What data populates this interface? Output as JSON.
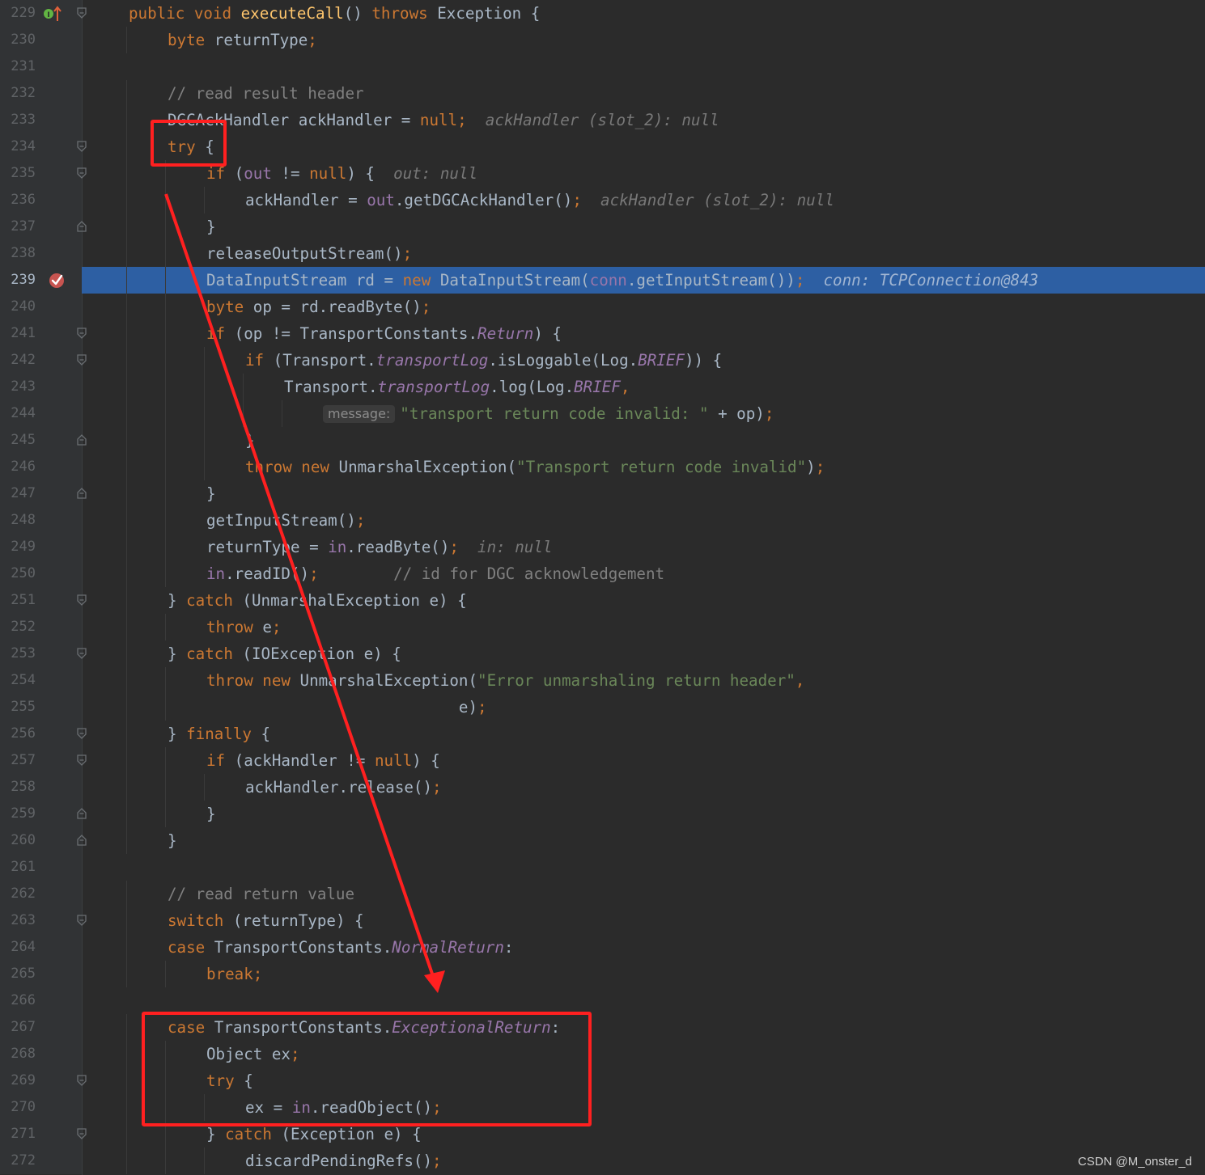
{
  "editor": {
    "lines": [
      {
        "n": "229",
        "indent": 0,
        "fold": "open",
        "seg": [
          [
            "kw",
            "public void "
          ],
          [
            "fn",
            "executeCall"
          ],
          [
            "",
            "() "
          ],
          [
            "kw",
            "throws "
          ],
          [
            "",
            "Exception {"
          ]
        ]
      },
      {
        "n": "230",
        "indent": 1,
        "seg": [
          [
            "kw",
            "byte "
          ],
          [
            "",
            "returnType"
          ],
          [
            "kw",
            ";"
          ]
        ]
      },
      {
        "n": "231",
        "indent": 0,
        "seg": []
      },
      {
        "n": "232",
        "indent": 1,
        "seg": [
          [
            "cmt",
            "// read result header"
          ]
        ]
      },
      {
        "n": "233",
        "indent": 1,
        "seg": [
          [
            "",
            "DGCAckHandler ackHandler = "
          ],
          [
            "kw",
            "null;"
          ],
          [
            "",
            "  "
          ],
          [
            "hint",
            "ackHandler (slot_2): null"
          ]
        ]
      },
      {
        "n": "234",
        "indent": 1,
        "fold": "open",
        "seg": [
          [
            "kw",
            "try "
          ],
          [
            "",
            "{"
          ]
        ]
      },
      {
        "n": "235",
        "indent": 2,
        "fold": "open",
        "seg": [
          [
            "kw",
            "if "
          ],
          [
            "",
            "("
          ],
          [
            "fld",
            "out"
          ],
          [
            "",
            " != "
          ],
          [
            "kw",
            "null"
          ],
          [
            "",
            ") {  "
          ],
          [
            "hint",
            "out: null"
          ]
        ]
      },
      {
        "n": "236",
        "indent": 3,
        "seg": [
          [
            "",
            "ackHandler = "
          ],
          [
            "fld",
            "out"
          ],
          [
            "",
            ".getDGCAckHandler()"
          ],
          [
            "kw",
            ";"
          ],
          [
            "",
            "  "
          ],
          [
            "hint",
            "ackHandler (slot_2): null"
          ]
        ]
      },
      {
        "n": "237",
        "indent": 2,
        "fold": "close",
        "seg": [
          [
            "",
            "}"
          ]
        ]
      },
      {
        "n": "238",
        "indent": 2,
        "seg": [
          [
            "",
            "releaseOutputStream()"
          ],
          [
            "kw",
            ";"
          ]
        ]
      },
      {
        "n": "239",
        "indent": 2,
        "hl": true,
        "seg": [
          [
            "",
            "DataInputStream rd = "
          ],
          [
            "kw",
            "new "
          ],
          [
            "",
            "DataInputStream("
          ],
          [
            "fld",
            "conn"
          ],
          [
            "",
            ".getInputStream())"
          ],
          [
            "kw",
            ";"
          ],
          [
            "",
            "  "
          ],
          [
            "hint",
            "conn: TCPConnection@843"
          ]
        ]
      },
      {
        "n": "240",
        "indent": 2,
        "seg": [
          [
            "kw",
            "byte "
          ],
          [
            "",
            "op = rd.readByte()"
          ],
          [
            "kw",
            ";"
          ]
        ]
      },
      {
        "n": "241",
        "indent": 2,
        "fold": "open",
        "seg": [
          [
            "kw",
            "if "
          ],
          [
            "",
            "(op != TransportConstants."
          ],
          [
            "ist",
            "Return"
          ],
          [
            "",
            ") {"
          ]
        ]
      },
      {
        "n": "242",
        "indent": 3,
        "fold": "open",
        "seg": [
          [
            "kw",
            "if "
          ],
          [
            "",
            "(Transport."
          ],
          [
            "ist",
            "transportLog"
          ],
          [
            "",
            ".isLoggable(Log."
          ],
          [
            "ist",
            "BRIEF"
          ],
          [
            "",
            ")) {"
          ]
        ]
      },
      {
        "n": "243",
        "indent": 4,
        "seg": [
          [
            "",
            "Transport."
          ],
          [
            "ist",
            "transportLog"
          ],
          [
            "",
            ".log(Log."
          ],
          [
            "ist",
            "BRIEF"
          ],
          [
            "kw",
            ","
          ]
        ]
      },
      {
        "n": "244",
        "indent": 5,
        "seg": [
          [
            "param",
            "message:"
          ],
          [
            "str",
            "\"transport return code invalid: \""
          ],
          [
            "",
            " + op)"
          ],
          [
            "kw",
            ";"
          ]
        ]
      },
      {
        "n": "245",
        "indent": 3,
        "fold": "close",
        "seg": [
          [
            "",
            "}"
          ]
        ]
      },
      {
        "n": "246",
        "indent": 3,
        "seg": [
          [
            "kw",
            "throw new "
          ],
          [
            "",
            "UnmarshalException("
          ],
          [
            "str",
            "\"Transport return code invalid\""
          ],
          [
            "",
            ")"
          ],
          [
            "kw",
            ";"
          ]
        ]
      },
      {
        "n": "247",
        "indent": 2,
        "fold": "close",
        "seg": [
          [
            "",
            "}"
          ]
        ]
      },
      {
        "n": "248",
        "indent": 2,
        "seg": [
          [
            "",
            "getInputStream()"
          ],
          [
            "kw",
            ";"
          ]
        ]
      },
      {
        "n": "249",
        "indent": 2,
        "seg": [
          [
            "",
            "returnType = "
          ],
          [
            "fld",
            "in"
          ],
          [
            "",
            ".readByte()"
          ],
          [
            "kw",
            ";"
          ],
          [
            "",
            "  "
          ],
          [
            "hint",
            "in: null"
          ]
        ]
      },
      {
        "n": "250",
        "indent": 2,
        "seg": [
          [
            "fld",
            "in"
          ],
          [
            "",
            ".readID()"
          ],
          [
            "kw",
            ";"
          ],
          [
            "",
            "        "
          ],
          [
            "cmt",
            "// id for DGC acknowledgement"
          ]
        ]
      },
      {
        "n": "251",
        "indent": 1,
        "fold": "open",
        "seg": [
          [
            "",
            "} "
          ],
          [
            "kw",
            "catch "
          ],
          [
            "",
            "(UnmarshalException e) {"
          ]
        ]
      },
      {
        "n": "252",
        "indent": 2,
        "seg": [
          [
            "kw",
            "throw "
          ],
          [
            "",
            "e"
          ],
          [
            "kw",
            ";"
          ]
        ]
      },
      {
        "n": "253",
        "indent": 1,
        "fold": "open",
        "seg": [
          [
            "",
            "} "
          ],
          [
            "kw",
            "catch "
          ],
          [
            "",
            "(IOException e) {"
          ]
        ]
      },
      {
        "n": "254",
        "indent": 2,
        "seg": [
          [
            "kw",
            "throw new "
          ],
          [
            "",
            "UnmarshalException("
          ],
          [
            "str",
            "\"Error unmarshaling return header\""
          ],
          [
            "kw",
            ","
          ]
        ]
      },
      {
        "n": "255",
        "indent": 2,
        "seg": [
          [
            "",
            "                           e)"
          ],
          [
            "kw",
            ";"
          ]
        ]
      },
      {
        "n": "256",
        "indent": 1,
        "fold": "open",
        "seg": [
          [
            "",
            "} "
          ],
          [
            "kw",
            "finally "
          ],
          [
            "",
            "{"
          ]
        ]
      },
      {
        "n": "257",
        "indent": 2,
        "fold": "open",
        "seg": [
          [
            "kw",
            "if "
          ],
          [
            "",
            "(ackHandler != "
          ],
          [
            "kw",
            "null"
          ],
          [
            "",
            ") {"
          ]
        ]
      },
      {
        "n": "258",
        "indent": 3,
        "seg": [
          [
            "",
            "ackHandler.release()"
          ],
          [
            "kw",
            ";"
          ]
        ]
      },
      {
        "n": "259",
        "indent": 2,
        "fold": "close",
        "seg": [
          [
            "",
            "}"
          ]
        ]
      },
      {
        "n": "260",
        "indent": 1,
        "fold": "close",
        "seg": [
          [
            "",
            "}"
          ]
        ]
      },
      {
        "n": "261",
        "indent": 0,
        "seg": []
      },
      {
        "n": "262",
        "indent": 1,
        "seg": [
          [
            "cmt",
            "// read return value"
          ]
        ]
      },
      {
        "n": "263",
        "indent": 1,
        "fold": "open",
        "seg": [
          [
            "kw",
            "switch "
          ],
          [
            "",
            "(returnType) {"
          ]
        ]
      },
      {
        "n": "264",
        "indent": 1,
        "seg": [
          [
            "kw",
            "case "
          ],
          [
            "",
            "TransportConstants."
          ],
          [
            "ist",
            "NormalReturn"
          ],
          [
            "",
            ":"
          ]
        ]
      },
      {
        "n": "265",
        "indent": 2,
        "seg": [
          [
            "kw",
            "break;"
          ]
        ]
      },
      {
        "n": "266",
        "indent": 0,
        "seg": []
      },
      {
        "n": "267",
        "indent": 1,
        "seg": [
          [
            "kw",
            "case "
          ],
          [
            "",
            "TransportConstants."
          ],
          [
            "ist",
            "ExceptionalReturn"
          ],
          [
            "",
            ":"
          ]
        ]
      },
      {
        "n": "268",
        "indent": 2,
        "seg": [
          [
            "",
            "Object ex"
          ],
          [
            "kw",
            ";"
          ]
        ]
      },
      {
        "n": "269",
        "indent": 2,
        "fold": "open",
        "seg": [
          [
            "kw",
            "try "
          ],
          [
            "",
            "{"
          ]
        ]
      },
      {
        "n": "270",
        "indent": 3,
        "seg": [
          [
            "",
            "ex = "
          ],
          [
            "fld",
            "in"
          ],
          [
            "",
            ".readObject()"
          ],
          [
            "kw",
            ";"
          ]
        ]
      },
      {
        "n": "271",
        "indent": 2,
        "fold": "open",
        "seg": [
          [
            "",
            "} "
          ],
          [
            "kw",
            "catch "
          ],
          [
            "",
            "(Exception e) {"
          ]
        ]
      },
      {
        "n": "272",
        "indent": 3,
        "seg": [
          [
            "",
            "discardPendingRefs()"
          ],
          [
            "kw",
            ";"
          ]
        ]
      }
    ]
  },
  "gutter_icons": {
    "line_229": "implements-method-icon",
    "line_239": "breakpoint-icon"
  },
  "colors": {
    "background": "#2b2b2b",
    "gutter": "#313335",
    "execution_line": "#2d5fa3",
    "annotation": "#ff2020",
    "keyword": "#cc7832",
    "method": "#ffc66d",
    "field": "#9876aa",
    "string": "#6a8759",
    "comment": "#808080"
  },
  "watermark": "CSDN @M_onster_d"
}
